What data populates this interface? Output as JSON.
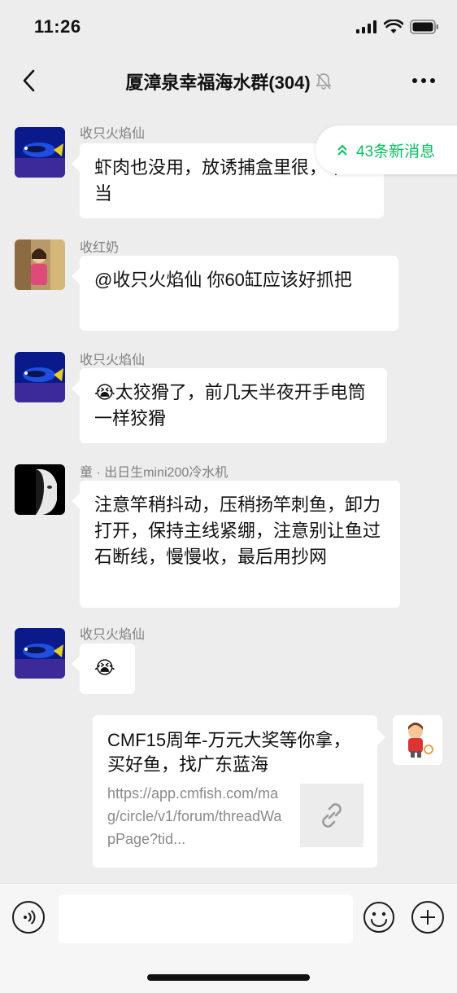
{
  "status_bar": {
    "time": "11:26"
  },
  "nav": {
    "title": "厦漳泉幸福海水群(304)"
  },
  "new_messages": {
    "label": "43条新消息"
  },
  "messages": [
    {
      "sender": "收只火焰仙",
      "text": "虾肉也没用，放诱捕盒里很，不上当",
      "avatar": "blue-fish-avatar"
    },
    {
      "sender": "收红奶",
      "text": "@收只火焰仙 你60缸应该好抓把",
      "avatar": "child-photo-avatar"
    },
    {
      "sender": "收只火焰仙",
      "text": "😭太狡猾了，前几天半夜开手电筒一样狡猾",
      "avatar": "blue-fish-avatar"
    },
    {
      "sender": "童 · 出日生mini200冷水机",
      "text": "注意竿稍抖动，压稍扬竿刺鱼，卸力打开，保持主线紧绷，注意别让鱼过石断线，慢慢收，最后用抄网",
      "avatar": "portrait-avatar"
    },
    {
      "sender": "收只火焰仙",
      "text": "😭",
      "avatar": "blue-fish-avatar"
    }
  ],
  "link_message": {
    "title": "CMF15周年-万元大奖等你拿，买好鱼，找广东蓝海",
    "url": "https://app.cmfish.com/mag/circle/v1/forum/threadWapPage?tid...",
    "thumb_icon": "link-icon"
  },
  "input_bar": {
    "placeholder": ""
  },
  "colors": {
    "accent": "#07c160",
    "background": "#ededed",
    "bubble": "#ffffff",
    "meta_text": "#7f7f7f"
  }
}
